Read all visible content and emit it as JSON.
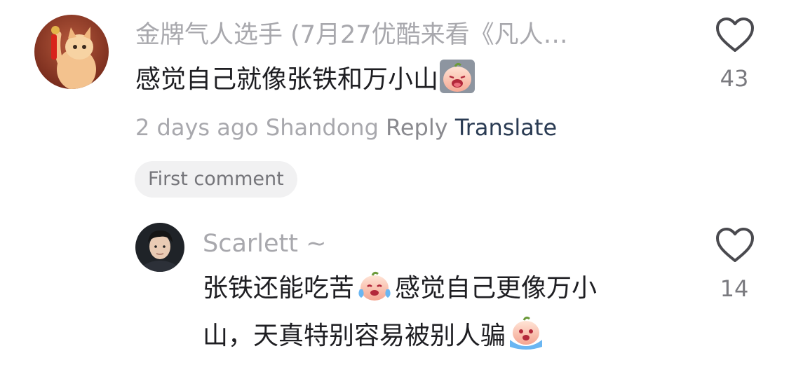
{
  "comments": [
    {
      "username": "金牌气人选手 (7月27优酷来看《凡人…",
      "text": "感觉自己就像张铁和万小山",
      "timestamp": "2 days ago",
      "location": "Shandong",
      "reply_label": "Reply",
      "translate_label": "Translate",
      "badge": "First comment",
      "likes": "43",
      "icons": [
        "cat-avatar",
        "crying-peach-emoji",
        "heart-outline-icon"
      ]
    },
    {
      "username": "Scarlett ~",
      "text_line1_a": "张铁还能吃苦",
      "text_line1_b": "感觉自己更像万小",
      "text_line2": "山，天真特别容易被别人骗",
      "likes": "14",
      "icons": [
        "man-avatar",
        "crying-peach-emoji",
        "heart-outline-icon"
      ]
    }
  ],
  "colors": {
    "username": "#a8a8ad",
    "text": "#1e1e22",
    "translate": "#2a3b53",
    "chip_bg": "#f1f1f2"
  }
}
